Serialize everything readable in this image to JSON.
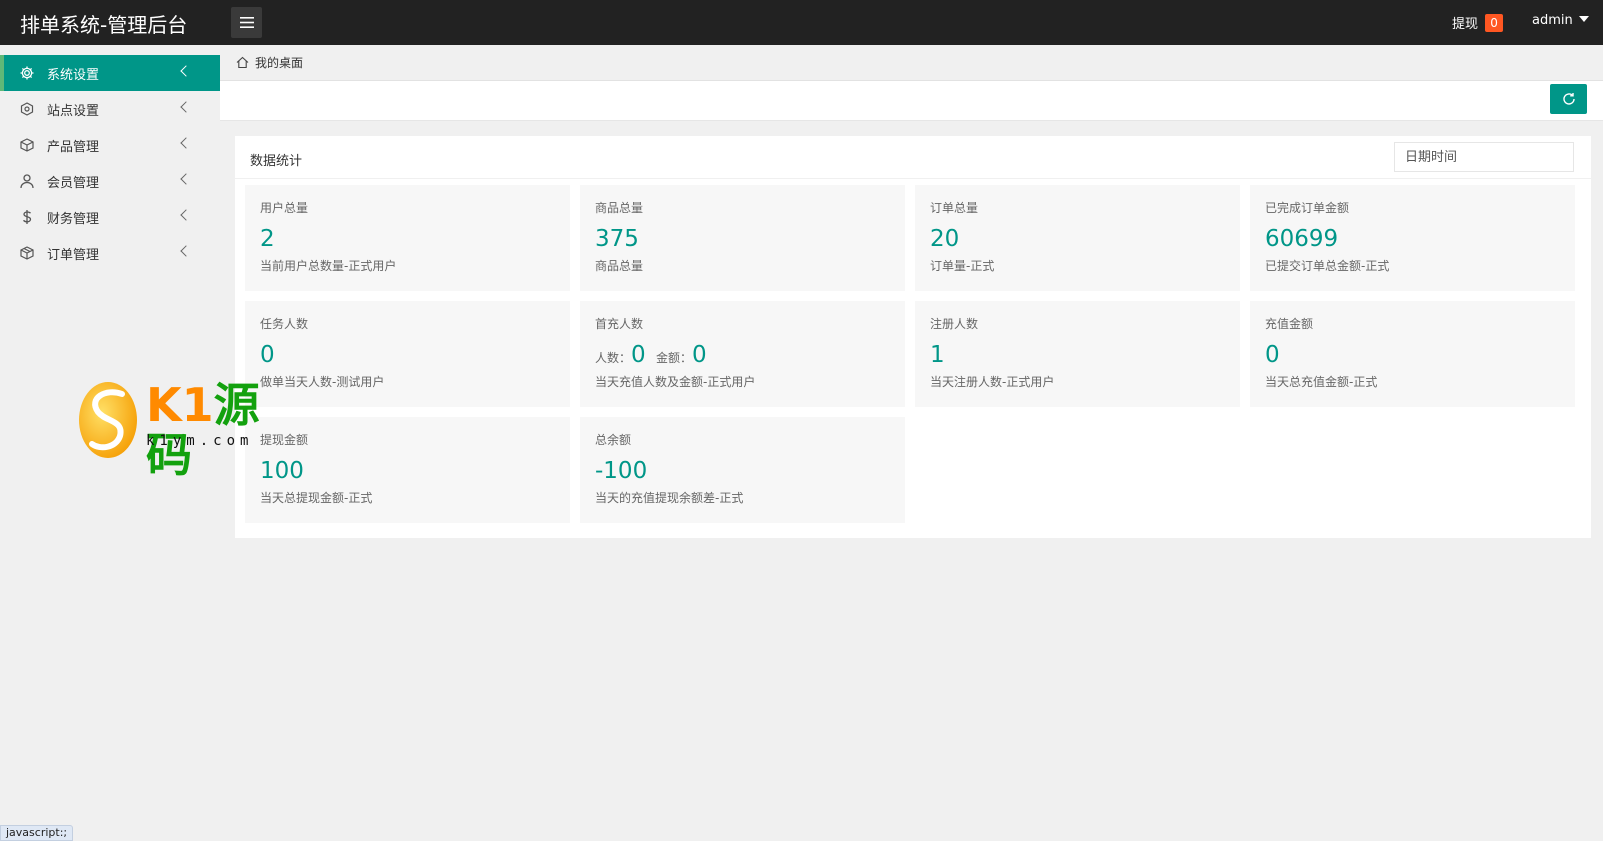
{
  "header": {
    "title": "排单系统-管理后台",
    "withdraw_label": "提现",
    "withdraw_count": "0",
    "user_name": "admin"
  },
  "sidebar": {
    "items": [
      {
        "label": "系统设置",
        "icon": "gear-icon",
        "active": true
      },
      {
        "label": "站点设置",
        "icon": "site-icon",
        "active": false
      },
      {
        "label": "产品管理",
        "icon": "box-icon",
        "active": false
      },
      {
        "label": "会员管理",
        "icon": "user-icon",
        "active": false
      },
      {
        "label": "财务管理",
        "icon": "dollar-icon",
        "active": false
      },
      {
        "label": "订单管理",
        "icon": "cube-icon",
        "active": false
      }
    ]
  },
  "breadcrumb": {
    "label": "我的桌面"
  },
  "panel": {
    "title": "数据统计",
    "date_placeholder": "日期时间"
  },
  "stats": [
    {
      "label": "用户总量",
      "value": "2",
      "desc": "当前用户总数量-正式用户"
    },
    {
      "label": "商品总量",
      "value": "375",
      "desc": "商品总量"
    },
    {
      "label": "订单总量",
      "value": "20",
      "desc": "订单量-正式"
    },
    {
      "label": "已完成订单金额",
      "value": "60699",
      "desc": "已提交订单总金额-正式"
    },
    {
      "label": "任务人数",
      "value": "0",
      "desc": "做单当天人数-测试用户"
    },
    {
      "label": "首充人数",
      "people_label": "人数：",
      "people_value": "0",
      "amount_label": "金额：",
      "amount_value": "0",
      "desc": "当天充值人数及金额-正式用户"
    },
    {
      "label": "注册人数",
      "value": "1",
      "desc": "当天注册人数-正式用户"
    },
    {
      "label": "充值金额",
      "value": "0",
      "desc": "当天总充值金额-正式"
    },
    {
      "label": "提现金额",
      "value": "100",
      "desc": "当天总提现金额-正式"
    },
    {
      "label": "总余额",
      "value": "-100",
      "desc": "当天的充值提现余额差-正式"
    }
  ],
  "watermark": {
    "brand": "K1",
    "brand_cn": "源码",
    "url": "k1ym.com"
  },
  "status_bar": {
    "text": "javascript:;"
  },
  "colors": {
    "accent": "#009688",
    "badge": "#ff5722",
    "header_bg": "#222222"
  }
}
